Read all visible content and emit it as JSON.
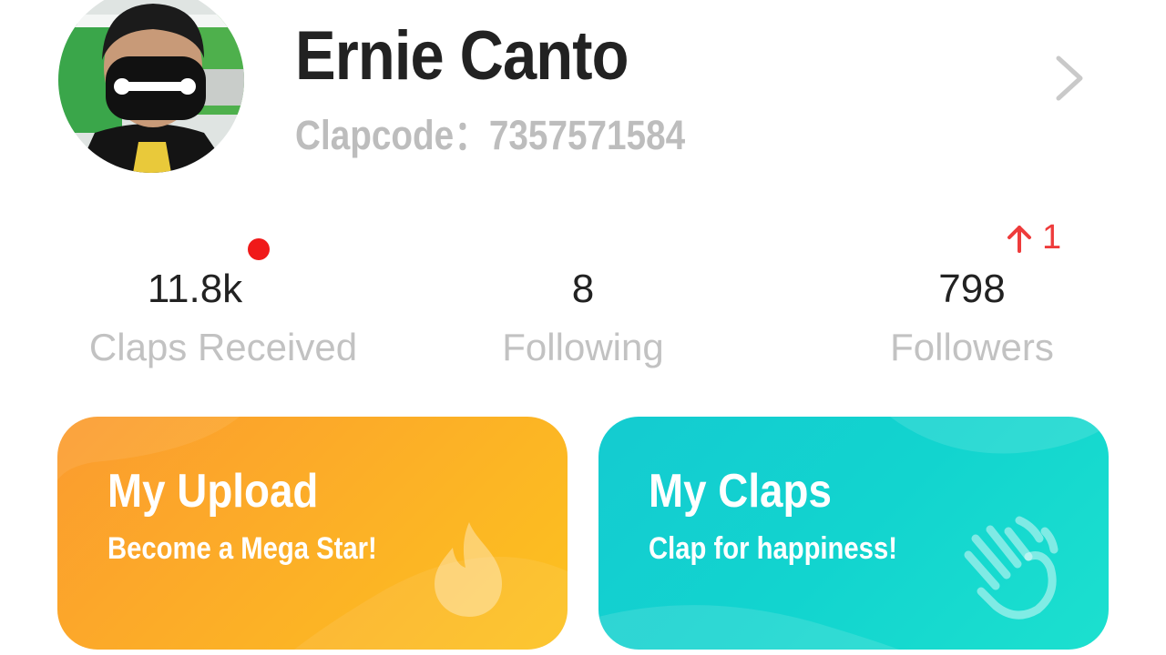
{
  "profile": {
    "name": "Ernie Canto",
    "clapcode": "Clapcode：7357571584"
  },
  "stats": {
    "claps_received": {
      "value": "11.8k",
      "label": "Claps Received",
      "has_notification_dot": true
    },
    "following": {
      "value": "8",
      "label": "Following"
    },
    "followers": {
      "value": "798",
      "label": "Followers",
      "increase": "1"
    }
  },
  "cards": {
    "upload": {
      "title": "My Upload",
      "subtitle": "Become a Mega Star!",
      "icon": "flame-icon"
    },
    "claps": {
      "title": "My Claps",
      "subtitle": "Clap for happiness!",
      "icon": "clapping-hand-icon"
    }
  },
  "colors": {
    "notification": "#f01919",
    "increase": "#ee3b3b",
    "upload_card": "#fcab29",
    "claps_card": "#14d0cf"
  }
}
